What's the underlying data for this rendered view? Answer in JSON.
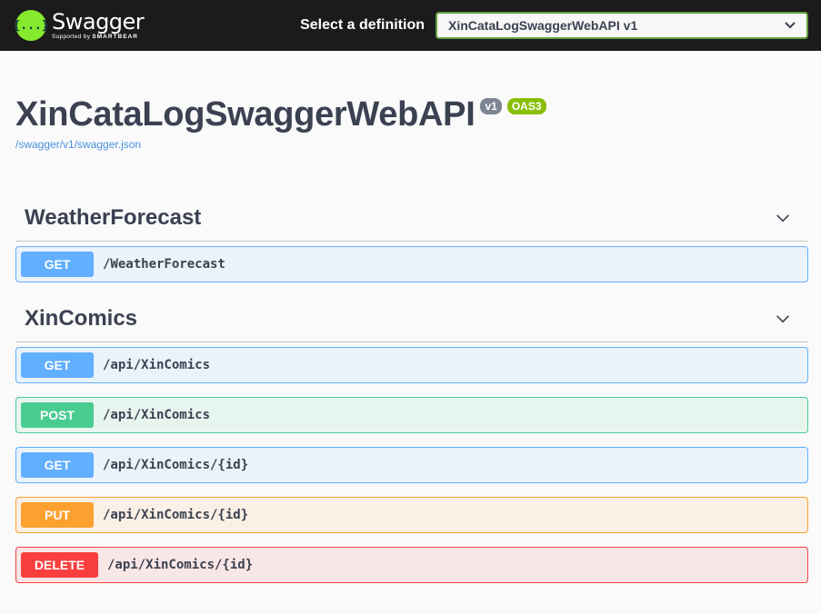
{
  "topbar": {
    "logo_glyph": "{...}",
    "logo_name": "Swagger",
    "logo_sub_prefix": "Supported by",
    "logo_sub_brand": "SMARTBEAR",
    "definition_label": "Select a definition",
    "definition_value": "XinCataLogSwaggerWebAPI v1"
  },
  "info": {
    "title": "XinCataLogSwaggerWebAPI",
    "version_badge": "v1",
    "oas_badge": "OAS3",
    "spec_link": "/swagger/v1/swagger.json"
  },
  "tags": [
    {
      "name": "WeatherForecast",
      "operations": [
        {
          "method": "GET",
          "path": "/WeatherForecast"
        }
      ]
    },
    {
      "name": "XinComics",
      "operations": [
        {
          "method": "GET",
          "path": "/api/XinComics"
        },
        {
          "method": "POST",
          "path": "/api/XinComics"
        },
        {
          "method": "GET",
          "path": "/api/XinComics/{id}"
        },
        {
          "method": "PUT",
          "path": "/api/XinComics/{id}"
        },
        {
          "method": "DELETE",
          "path": "/api/XinComics/{id}"
        }
      ]
    }
  ],
  "colors": {
    "topbar_bg": "#1b1b1b",
    "logo_green": "#85ea2d",
    "get": "#61affe",
    "post": "#49cc90",
    "put": "#fca130",
    "delete": "#f93e3e"
  },
  "icons": {
    "definition_dropdown": "chevron-down-icon",
    "tag_toggle": "chevron-down-icon"
  }
}
